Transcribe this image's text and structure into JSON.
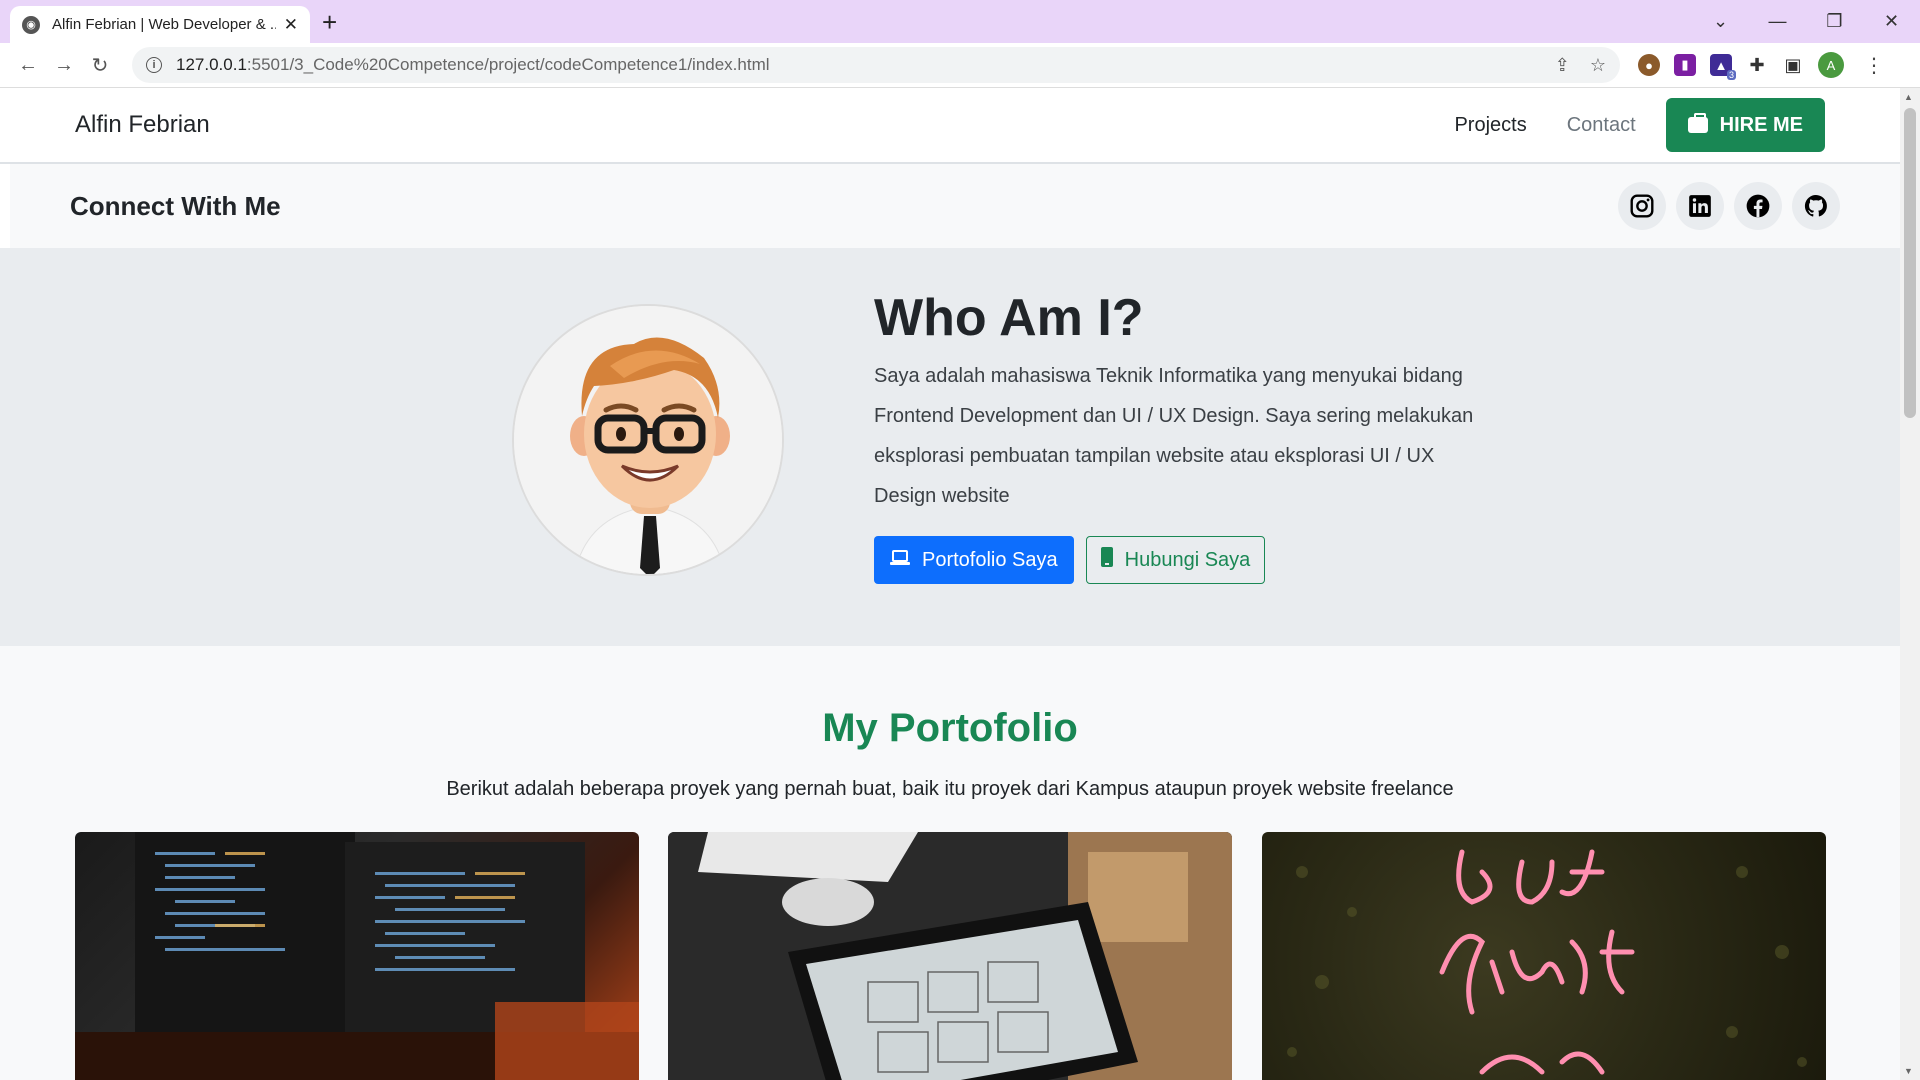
{
  "browser": {
    "tab_title": "Alfin Febrian | Web Developer & ...",
    "url_host": "127.0.0.1",
    "url_path": ":5501/3_Code%20Competence/project/codeCompetence1/index.html",
    "profile_initial": "A",
    "extension_badge": "3"
  },
  "navbar": {
    "brand": "Alfin Febrian",
    "links": [
      "Projects",
      "Contact"
    ],
    "hire_label": "HIRE ME"
  },
  "connect": {
    "title": "Connect With Me",
    "socials": [
      "instagram-icon",
      "linkedin-icon",
      "facebook-icon",
      "github-icon"
    ]
  },
  "hero": {
    "heading": "Who Am I?",
    "paragraph_lines": [
      "Saya adalah mahasiswa Teknik Informatika yang menyukai bidang",
      "Frontend Development dan UI / UX Design. Saya sering melakukan",
      "eksplorasi pembuatan tampilan website atau eksplorasi UI / UX",
      "Design website"
    ],
    "primary_button": "Portofolio Saya",
    "secondary_button": "Hubungi Saya"
  },
  "portfolio": {
    "title": "My Portofolio",
    "subtitle": "Berikut adalah beberapa proyek yang pernah buat, baik itu proyek dari Kampus ataupun proyek website freelance"
  },
  "colors": {
    "success": "#198754",
    "primary": "#0d6efd",
    "hero_bg": "#e9ecef"
  }
}
